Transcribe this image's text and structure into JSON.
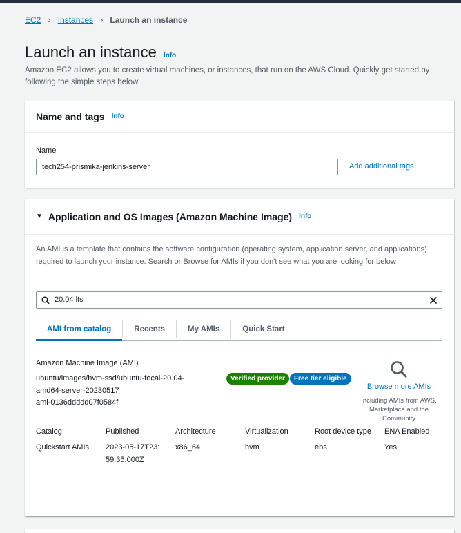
{
  "breadcrumb": {
    "ec2": "EC2",
    "instances": "Instances",
    "current": "Launch an instance"
  },
  "header": {
    "title": "Launch an instance",
    "info": "Info",
    "description": "Amazon EC2 allows you to create virtual machines, or instances, that run on the AWS Cloud. Quickly get started by following the simple steps below."
  },
  "name_tags": {
    "title": "Name and tags",
    "info": "Info",
    "name_label": "Name",
    "name_value": "tech254-prismika-jenkins-server",
    "add_tags": "Add additional tags"
  },
  "ami": {
    "title": "Application and OS Images (Amazon Machine Image)",
    "info": "Info",
    "description": "An AMI is a template that contains the software configuration (operating system, application server, and applications) required to launch your instance. Search or Browse for AMIs if you don't see what you are looking for below",
    "search_value": "20.04 lts",
    "tabs": [
      "AMI from catalog",
      "Recents",
      "My AMIs",
      "Quick Start"
    ],
    "selected": {
      "heading": "Amazon Machine Image (AMI)",
      "name_line1": "ubuntu/images/hvm-ssd/ubuntu-focal-20.04-",
      "name_line2": "amd64-server-20230517",
      "ami_id": "ami-0136ddddd07f0584f",
      "badge_verified": "Verified provider",
      "badge_free": "Free tier eligible"
    },
    "browse": {
      "label": "Browse more AMIs",
      "sub": "Including AMIs from AWS, Marketplace and the Community"
    },
    "details": {
      "headers": [
        "Catalog",
        "Published",
        "Architecture",
        "Virtualization",
        "Root device type",
        "ENA Enabled"
      ],
      "values": [
        "Quickstart AMIs",
        "2023-05-17T23:59:35.000Z",
        "x86_64",
        "hvm",
        "ebs",
        "Yes"
      ]
    }
  },
  "colors": {
    "link": "#0073bb",
    "verified_badge": "#1d8102",
    "free_tier_badge": "#0073bb"
  }
}
